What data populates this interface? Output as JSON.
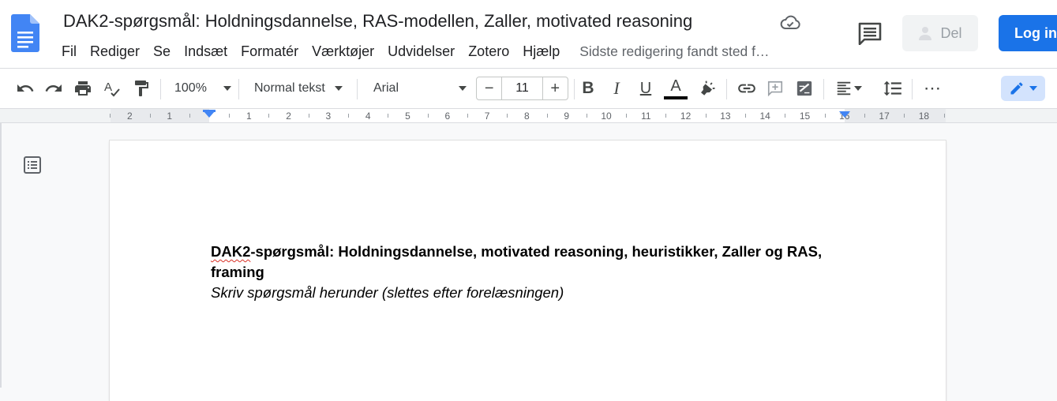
{
  "document": {
    "title": "DAK2-spørgsmål: Holdningsdannelse, RAS-modellen, Zaller, motivated reasoning",
    "last_edit": "Sidste redigering fandt sted f…"
  },
  "menu": [
    "Fil",
    "Rediger",
    "Se",
    "Indsæt",
    "Formatér",
    "Værktøjer",
    "Udvidelser",
    "Zotero",
    "Hjælp"
  ],
  "actions": {
    "share_label": "Del",
    "login_label": "Log in"
  },
  "toolbar": {
    "zoom": "100%",
    "style": "Normal tekst",
    "font": "Arial",
    "font_size": "11",
    "bold_glyph": "B",
    "italic_glyph": "I",
    "underline_glyph": "U",
    "textcolor_glyph": "A",
    "more_glyph": "⋯",
    "minus_glyph": "−",
    "plus_glyph": "+"
  },
  "ruler": {
    "labels": [
      "2",
      "1",
      "1",
      "2",
      "3",
      "4",
      "5",
      "6",
      "7",
      "8",
      "9",
      "10",
      "11",
      "12",
      "13",
      "14",
      "15",
      "16",
      "17",
      "18"
    ]
  },
  "body": {
    "heading_word": "DAK2",
    "heading_rest": "-spørgsmål: Holdningsdannelse, motivated reasoning, heuristikker, Zaller og RAS, framing",
    "subline": "Skriv spørgsmål herunder (slettes efter forelæsningen)"
  },
  "icons": {
    "logo": "docs-logo-icon",
    "cloud": "cloud-saved-icon",
    "comment": "comment-icon",
    "person": "person-icon",
    "outline": "document-outline-icon",
    "edit": "pencil-icon"
  },
  "colors": {
    "accent": "#1a73e8",
    "docs_blue": "#4285f4",
    "text": "#202124",
    "muted": "#5f6368"
  }
}
